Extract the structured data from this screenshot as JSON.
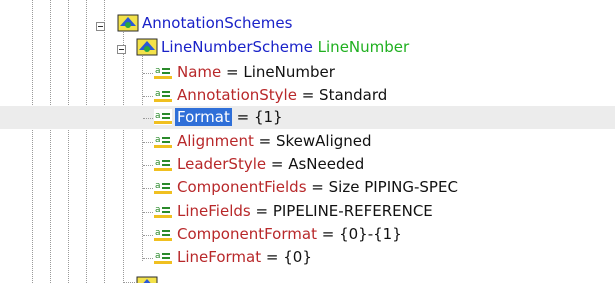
{
  "tree": {
    "root_node": {
      "name": "AnnotationSchemes",
      "icon": "scheme-node-icon",
      "expanded": true
    },
    "scheme_node": {
      "name": "LineNumberScheme",
      "type": "LineNumber",
      "icon": "scheme-node-icon",
      "expanded": true
    },
    "properties": [
      {
        "name": "Name",
        "sep": " = ",
        "value": "LineNumber",
        "selected": false
      },
      {
        "name": "AnnotationStyle",
        "sep": " = ",
        "value": "Standard",
        "selected": false
      },
      {
        "name": "Format",
        "sep": " = ",
        "value": "{1}",
        "selected": true
      },
      {
        "name": "Alignment",
        "sep": " = ",
        "value": "SkewAligned",
        "selected": false
      },
      {
        "name": "LeaderStyle",
        "sep": " = ",
        "value": "AsNeeded",
        "selected": false
      },
      {
        "name": "ComponentFields",
        "sep": " = ",
        "value": "Size PIPING-SPEC",
        "selected": false
      },
      {
        "name": "LineFields",
        "sep": " = ",
        "value": "PIPELINE-REFERENCE",
        "selected": false
      },
      {
        "name": "ComponentFormat",
        "sep": " = ",
        "value": "{0}-{1}",
        "selected": false
      },
      {
        "name": "LineFormat",
        "sep": " = ",
        "value": "{0}",
        "selected": false
      }
    ],
    "property_icon": "attribute-icon"
  },
  "colors": {
    "node_text": "#1a22c8",
    "type_text": "#20b020",
    "property_name": "#b8282a",
    "value_text": "#111111",
    "selection": "#2f6fd8",
    "selected_row": "#ececec"
  }
}
